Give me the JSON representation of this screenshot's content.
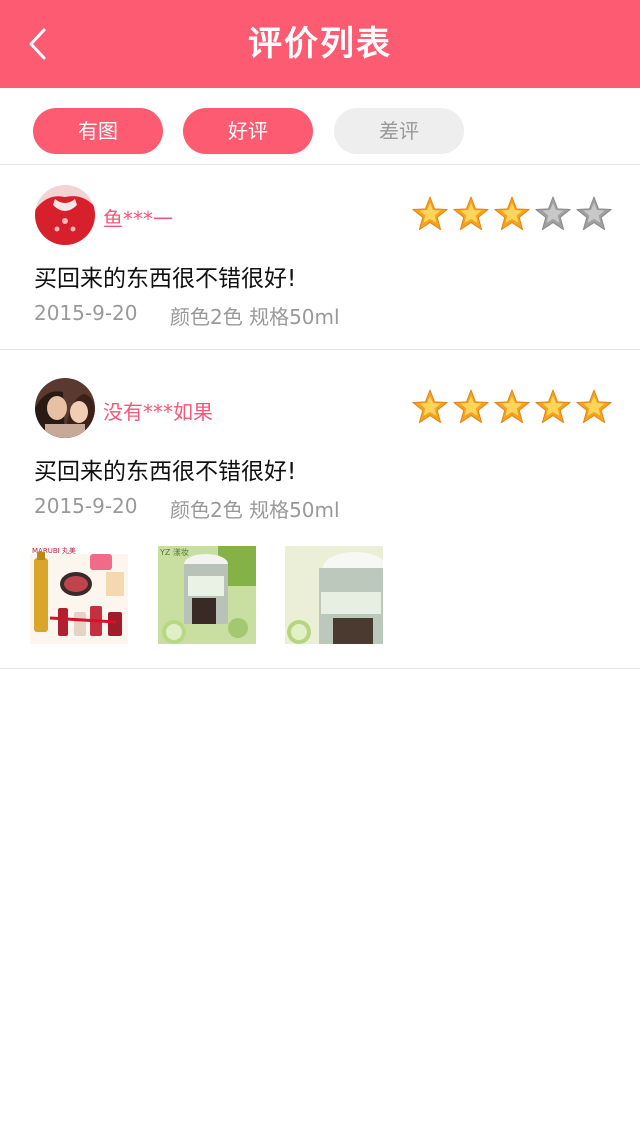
{
  "header": {
    "title": "评价列表",
    "back_icon": "back-arrow-icon"
  },
  "filters": [
    {
      "label": "有图",
      "active": true
    },
    {
      "label": "好评",
      "active": true
    },
    {
      "label": "差评",
      "active": false
    }
  ],
  "colors": {
    "accent": "#fd5b72",
    "username": "#f4577a",
    "meta": "#999999",
    "star_on": "#f7a21b",
    "star_off": "#a0a0a0"
  },
  "reviews": [
    {
      "username": "鱼***一",
      "rating": 3,
      "max_rating": 5,
      "comment": "买回来的东西很不错很好!",
      "date": "2015-9-20",
      "spec": "颜色2色  规格50ml",
      "images": []
    },
    {
      "username": "没有***如果",
      "rating": 5,
      "max_rating": 5,
      "comment": "买回来的东西很不错很好!",
      "date": "2015-9-20",
      "spec": "颜色2色  规格50ml",
      "images": [
        {
          "brand_text": "MARUBI 丸美"
        },
        {
          "brand_text": "YZ 漾妆"
        },
        {
          "brand_text": ""
        }
      ]
    }
  ]
}
